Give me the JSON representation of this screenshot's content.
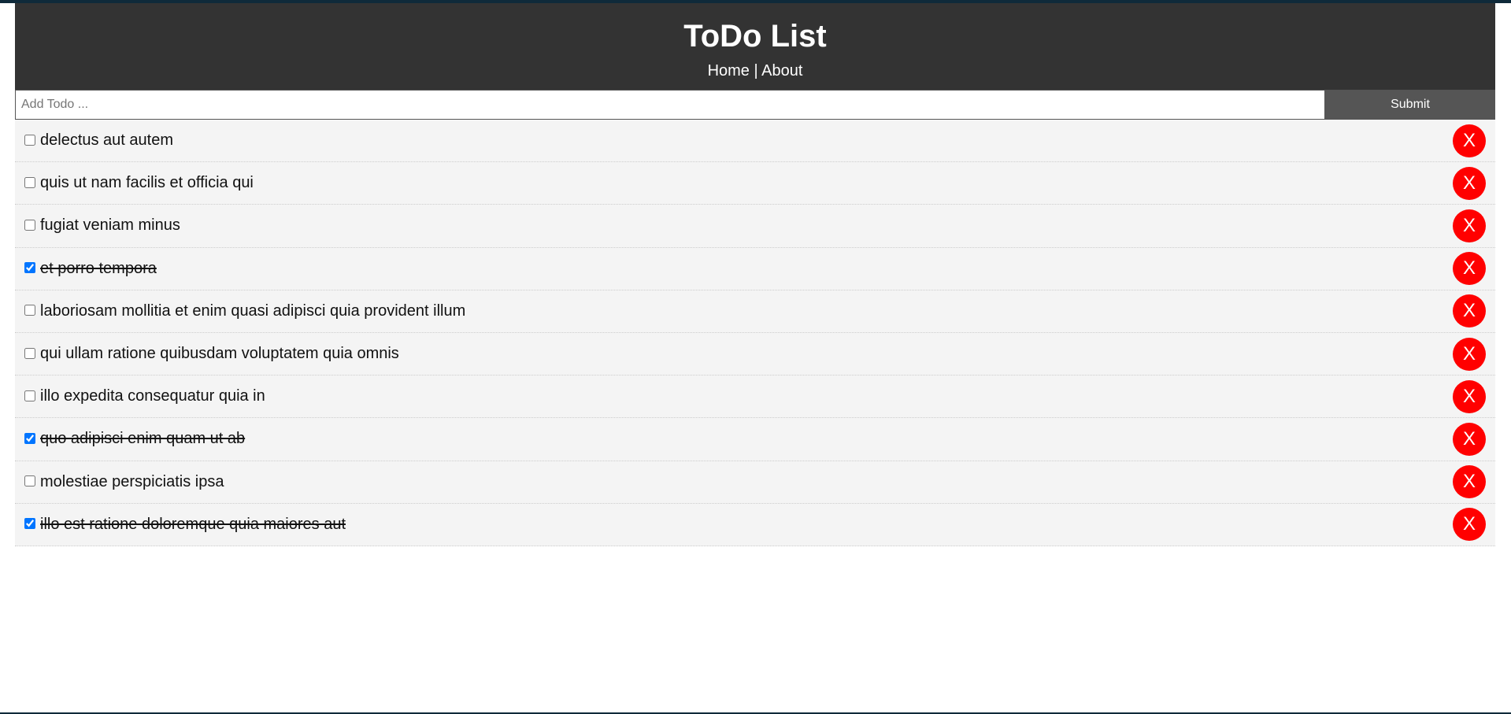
{
  "header": {
    "title": "ToDo List",
    "nav": {
      "home_label": "Home",
      "separator": "|",
      "about_label": "About"
    }
  },
  "add_todo": {
    "placeholder": "Add Todo ...",
    "value": "",
    "submit_label": "Submit"
  },
  "todos": [
    {
      "title": "delectus aut autem",
      "completed": false,
      "delete_label": "X"
    },
    {
      "title": "quis ut nam facilis et officia qui",
      "completed": false,
      "delete_label": "X"
    },
    {
      "title": "fugiat veniam minus",
      "completed": false,
      "delete_label": "X"
    },
    {
      "title": "et porro tempora",
      "completed": true,
      "delete_label": "X"
    },
    {
      "title": "laboriosam mollitia et enim quasi adipisci quia provident illum",
      "completed": false,
      "delete_label": "X"
    },
    {
      "title": "qui ullam ratione quibusdam voluptatem quia omnis",
      "completed": false,
      "delete_label": "X"
    },
    {
      "title": "illo expedita consequatur quia in",
      "completed": false,
      "delete_label": "X"
    },
    {
      "title": "quo adipisci enim quam ut ab",
      "completed": true,
      "delete_label": "X"
    },
    {
      "title": "molestiae perspiciatis ipsa",
      "completed": false,
      "delete_label": "X"
    },
    {
      "title": "illo est ratione doloremque quia maiores aut",
      "completed": true,
      "delete_label": "X"
    }
  ],
  "colors": {
    "header_bg": "#333333",
    "submit_bg": "#555555",
    "delete_bg": "#ff0000",
    "item_bg": "#f4f4f4"
  }
}
